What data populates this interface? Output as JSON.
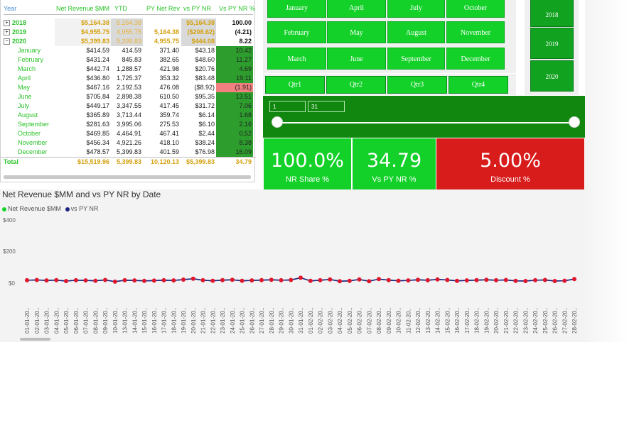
{
  "table": {
    "headers": [
      "Year",
      "Net Revenue $MM",
      "YTD",
      "PY Net Rev",
      "vs PY NR",
      "Vs PY NR %"
    ],
    "years": [
      {
        "label": "2018",
        "nr": "$5,164.38",
        "ytd": "5,164.38",
        "py": "",
        "vs": "$5,164.38",
        "pct": "100.00"
      },
      {
        "label": "2019",
        "nr": "$4,955.75",
        "ytd": "4,955.75",
        "py": "5,164.38",
        "vs": "($208.62)",
        "pct": "(4.21)"
      },
      {
        "label": "2020",
        "nr": "$5,399.83",
        "ytd": "5,399.83",
        "py": "4,955.75",
        "vs": "$444.08",
        "pct": "8.22"
      }
    ],
    "months": [
      {
        "label": "January",
        "nr": "$414.59",
        "ytd": "414.59",
        "py": "371.40",
        "vs": "$43.18",
        "pct": "10.42"
      },
      {
        "label": "February",
        "nr": "$431.24",
        "ytd": "845.83",
        "py": "382.65",
        "vs": "$48.60",
        "pct": "11.27"
      },
      {
        "label": "March",
        "nr": "$442.74",
        "ytd": "1,288.57",
        "py": "421.98",
        "vs": "$20.76",
        "pct": "4.69"
      },
      {
        "label": "April",
        "nr": "$436.80",
        "ytd": "1,725.37",
        "py": "353.32",
        "vs": "$83.48",
        "pct": "19.11"
      },
      {
        "label": "May",
        "nr": "$467.16",
        "ytd": "2,192.53",
        "py": "476.08",
        "vs": "($8.92)",
        "pct": "(1.91)"
      },
      {
        "label": "June",
        "nr": "$705.84",
        "ytd": "2,898.38",
        "py": "610.50",
        "vs": "$95.35",
        "pct": "13.51"
      },
      {
        "label": "July",
        "nr": "$449.17",
        "ytd": "3,347.55",
        "py": "417.45",
        "vs": "$31.72",
        "pct": "7.06"
      },
      {
        "label": "August",
        "nr": "$365.89",
        "ytd": "3,713.44",
        "py": "359.74",
        "vs": "$6.14",
        "pct": "1.68"
      },
      {
        "label": "September",
        "nr": "$281.63",
        "ytd": "3,995.06",
        "py": "275.53",
        "vs": "$6.10",
        "pct": "2.16"
      },
      {
        "label": "October",
        "nr": "$469.85",
        "ytd": "4,464.91",
        "py": "467.41",
        "vs": "$2.44",
        "pct": "0.52"
      },
      {
        "label": "November",
        "nr": "$456.34",
        "ytd": "4,921.26",
        "py": "418.10",
        "vs": "$38.24",
        "pct": "8.38"
      },
      {
        "label": "December",
        "nr": "$478.57",
        "ytd": "5,399.83",
        "py": "401.59",
        "vs": "$76.98",
        "pct": "16.09"
      }
    ],
    "total": {
      "label": "Total",
      "nr": "$15,519.96",
      "ytd": "5,399.83",
      "py": "10,120.13",
      "vs": "$5,399.83",
      "pct": "34.79"
    }
  },
  "month_slicer": [
    "January",
    "April",
    "July",
    "October",
    "February",
    "May",
    "August",
    "November",
    "March",
    "June",
    "September",
    "December"
  ],
  "quarter_slicer": [
    "Qtr1",
    "Qtr2",
    "Qtr3",
    "Qtr4"
  ],
  "year_slicer": [
    "2018",
    "2019",
    "2020"
  ],
  "day_slider": {
    "from": "1",
    "to": "31"
  },
  "cards": {
    "nr_share": {
      "value": "100.0%",
      "label": "NR Share %"
    },
    "vs_py": {
      "value": "34.79",
      "label": "Vs PY NR %"
    },
    "discount": {
      "value": "5.00%",
      "label": "Discount %"
    }
  },
  "chart": {
    "title": "Net Revenue $MM and vs PY NR by Date",
    "legend": [
      "Net Revenue $MM",
      "vs PY NR"
    ]
  },
  "colors": {
    "accent_green": "#14d12a",
    "dark_green": "#11870f",
    "red": "#d81b1b",
    "series_net_revenue": "#e0162b",
    "series_vs_py": "#1a237e"
  },
  "chart_data": {
    "type": "line",
    "title": "Net Revenue $MM and vs PY NR by Date",
    "xlabel": "",
    "ylabel": "",
    "yticks": [
      "$400",
      "$200",
      "$0"
    ],
    "ylim": [
      0,
      400
    ],
    "grid": false,
    "legend_position": "top-left",
    "x": [
      "01-01-20..",
      "02-01-20..",
      "03-01-20..",
      "04-01-20..",
      "05-01-20..",
      "06-01-20..",
      "07-01-20..",
      "08-01-20..",
      "09-01-20..",
      "10-01-20..",
      "13-01-20..",
      "14-01-20..",
      "15-01-20..",
      "16-01-20..",
      "17-01-20..",
      "18-01-20..",
      "19-01-20..",
      "20-01-20..",
      "21-01-20..",
      "22-01-20..",
      "23-01-20..",
      "24-01-20..",
      "25-01-20..",
      "26-01-20..",
      "27-01-20..",
      "28-01-20..",
      "29-01-20..",
      "30-01-20..",
      "31-01-20..",
      "01-02-20..",
      "02-02-20..",
      "03-02-20..",
      "04-02-20..",
      "05-02-20..",
      "06-02-20..",
      "07-02-20..",
      "08-02-20..",
      "09-02-20..",
      "10-02-20..",
      "11-02-20..",
      "12-02-20..",
      "13-02-20..",
      "14-02-20..",
      "15-02-20..",
      "16-02-20..",
      "17-02-20..",
      "18-02-20..",
      "19-02-20..",
      "20-02-20..",
      "21-02-20..",
      "22-02-20..",
      "23-02-20..",
      "24-02-20..",
      "25-02-20..",
      "26-02-20..",
      "27-02-20..",
      "28-02-20.."
    ],
    "series": [
      {
        "name": "Net Revenue $MM",
        "values": [
          14,
          16,
          13,
          15,
          9,
          14,
          13,
          11,
          16,
          5,
          14,
          13,
          10,
          12,
          14,
          13,
          18,
          24,
          14,
          11,
          15,
          17,
          11,
          13,
          15,
          17,
          14,
          16,
          30,
          10,
          14,
          19,
          8,
          10,
          19,
          8,
          22,
          15,
          11,
          13,
          17,
          14,
          19,
          16,
          10,
          13,
          15,
          17,
          14,
          16,
          10,
          9,
          14,
          16,
          9,
          11,
          22
        ]
      },
      {
        "name": "vs PY NR",
        "values": [
          14,
          16,
          13,
          15,
          9,
          14,
          13,
          11,
          16,
          5,
          14,
          13,
          10,
          12,
          14,
          13,
          18,
          24,
          14,
          11,
          15,
          17,
          11,
          13,
          15,
          17,
          14,
          16,
          30,
          10,
          14,
          19,
          8,
          10,
          19,
          8,
          22,
          15,
          11,
          13,
          17,
          14,
          19,
          16,
          10,
          13,
          15,
          17,
          14,
          16,
          10,
          9,
          14,
          16,
          9,
          11,
          22
        ]
      }
    ]
  }
}
